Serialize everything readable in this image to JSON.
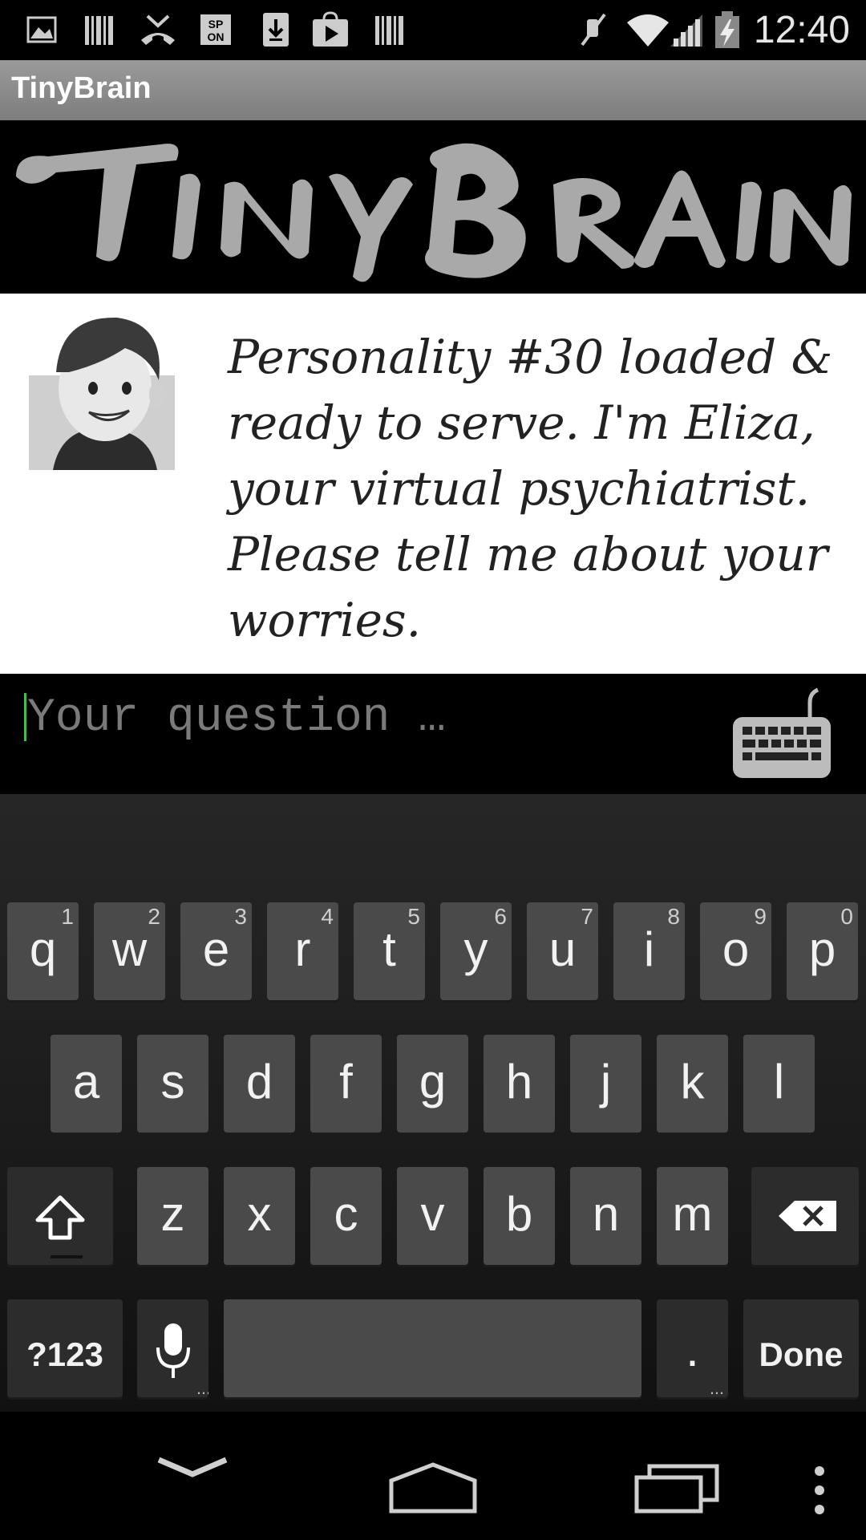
{
  "status_bar": {
    "time": "12:40",
    "icons": [
      "image-icon",
      "barcode-icon",
      "missed-call-icon",
      "spon-icon",
      "download-icon",
      "play-store-icon",
      "barcode-icon",
      "mute-icon",
      "wifi-icon",
      "signal-icon",
      "battery-charging-icon"
    ]
  },
  "app_bar": {
    "title": "TinyBrain"
  },
  "banner": {
    "logo_text": "TinyBrain"
  },
  "chat": {
    "message": "Personality #30 loaded & ready to serve. I'm Eliza, your virtual psychiatrist. Please tell me about your worries."
  },
  "input": {
    "placeholder": "Your question …",
    "value": ""
  },
  "keyboard": {
    "row1": [
      {
        "label": "q",
        "hint": "1"
      },
      {
        "label": "w",
        "hint": "2"
      },
      {
        "label": "e",
        "hint": "3"
      },
      {
        "label": "r",
        "hint": "4"
      },
      {
        "label": "t",
        "hint": "5"
      },
      {
        "label": "y",
        "hint": "6"
      },
      {
        "label": "u",
        "hint": "7"
      },
      {
        "label": "i",
        "hint": "8"
      },
      {
        "label": "o",
        "hint": "9"
      },
      {
        "label": "p",
        "hint": "0"
      }
    ],
    "row2": [
      "a",
      "s",
      "d",
      "f",
      "g",
      "h",
      "j",
      "k",
      "l"
    ],
    "row3": [
      "z",
      "x",
      "c",
      "v",
      "b",
      "n",
      "m"
    ],
    "symbols_label": "?123",
    "period_label": ".",
    "done_label": "Done"
  },
  "nav_bar": {
    "icons": [
      "hide-keyboard-icon",
      "home-icon",
      "recents-icon",
      "menu-icon"
    ]
  }
}
